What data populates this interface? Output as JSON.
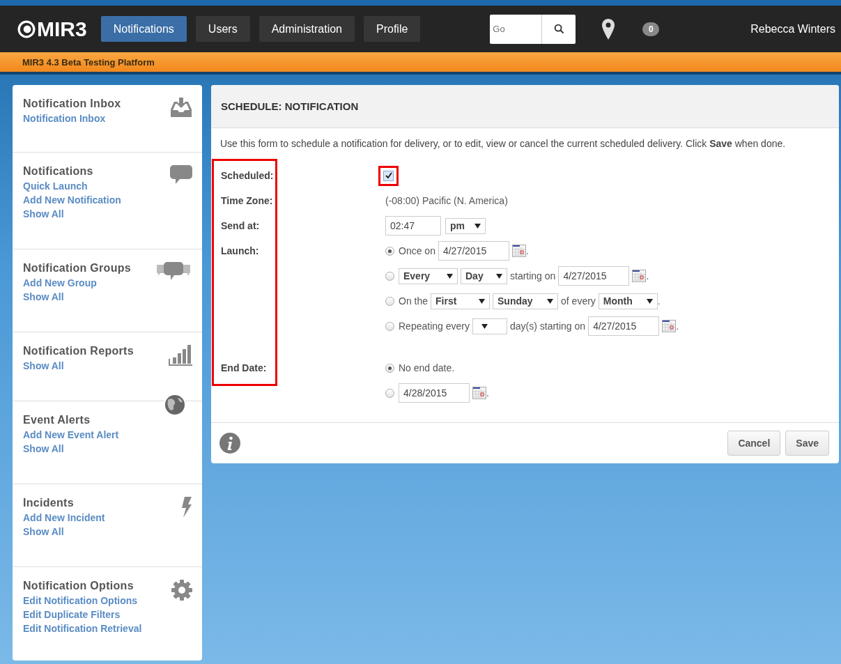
{
  "topbar": {
    "logo": "MIR3",
    "nav": [
      {
        "label": "Notifications",
        "selected": true
      },
      {
        "label": "Users",
        "selected": false
      },
      {
        "label": "Administration",
        "selected": false
      },
      {
        "label": "Profile",
        "selected": false
      }
    ],
    "search": {
      "placeholder": "Go"
    },
    "badge": "0",
    "user": "Rebecca Winters"
  },
  "banner": "MIR3 4.3 Beta Testing Platform",
  "sidebar": [
    {
      "title": "Notification Inbox",
      "kind": "inbox",
      "links": [
        "Notification Inbox"
      ]
    },
    {
      "title": "Notifications",
      "kind": "bubble",
      "links": [
        "Quick Launch",
        "Add New Notification",
        "Show All"
      ]
    },
    {
      "title": "Notification Groups",
      "kind": "bubbles",
      "links": [
        "Add New Group",
        "Show All"
      ]
    },
    {
      "title": "Notification Reports",
      "kind": "chart",
      "links": [
        "Show All"
      ]
    },
    {
      "title": "Event Alerts",
      "kind": "globe",
      "links": [
        "Add New Event Alert",
        "Show All"
      ]
    },
    {
      "title": "Incidents",
      "kind": "bolt",
      "links": [
        "Add New Incident",
        "Show All"
      ]
    },
    {
      "title": "Notification Options",
      "kind": "gear",
      "links": [
        "Edit Notification Options",
        "Edit Duplicate Filters",
        "Edit Notification Retrieval"
      ]
    }
  ],
  "panel": {
    "title": "SCHEDULE: NOTIFICATION",
    "intro": "Use this form to schedule a notification for delivery, or to edit, view or cancel the current scheduled delivery. Click **Save** when done.",
    "labels_highlighted": true,
    "scheduled": {
      "label": "Scheduled:",
      "checked": true,
      "highlighted": true
    },
    "time_zone": {
      "label": "Time Zone:",
      "value": "(-08:00) Pacific (N. America)"
    },
    "send_at": {
      "label": "Send at:",
      "time": "02:47",
      "period": "pm"
    },
    "launch": {
      "label": "Launch:",
      "options": [
        {
          "selected": true,
          "parts": [
            {
              "kind": "text",
              "text": "Once on"
            },
            {
              "kind": "date",
              "value": "4/27/2015"
            },
            {
              "kind": "text",
              "text": "."
            }
          ]
        },
        {
          "selected": false,
          "parts": [
            {
              "kind": "select",
              "value": "Every"
            },
            {
              "kind": "select",
              "value": "Day"
            },
            {
              "kind": "text",
              "text": "starting on"
            },
            {
              "kind": "date",
              "value": "4/27/2015"
            },
            {
              "kind": "text",
              "text": "."
            }
          ]
        },
        {
          "selected": false,
          "parts": [
            {
              "kind": "text",
              "text": "On the"
            },
            {
              "kind": "select",
              "value": "First"
            },
            {
              "kind": "select",
              "value": "Sunday"
            },
            {
              "kind": "text",
              "text": "of every"
            },
            {
              "kind": "select",
              "value": "Month"
            },
            {
              "kind": "text",
              "text": "."
            }
          ]
        },
        {
          "selected": false,
          "parts": [
            {
              "kind": "text",
              "text": "Repeating every"
            },
            {
              "kind": "select"
            },
            {
              "kind": "text",
              "text": "day(s) starting on"
            },
            {
              "kind": "date",
              "value": "4/27/2015"
            },
            {
              "kind": "text",
              "text": "."
            }
          ]
        }
      ]
    },
    "end_date": {
      "label": "End Date:",
      "options": [
        {
          "selected": true,
          "parts": [
            {
              "kind": "text",
              "text": "No end date."
            }
          ]
        },
        {
          "selected": false,
          "parts": [
            {
              "kind": "date",
              "value": "4/28/2015"
            },
            {
              "kind": "text",
              "text": "."
            }
          ]
        }
      ]
    },
    "buttons": [
      "Cancel",
      "Save"
    ]
  }
}
